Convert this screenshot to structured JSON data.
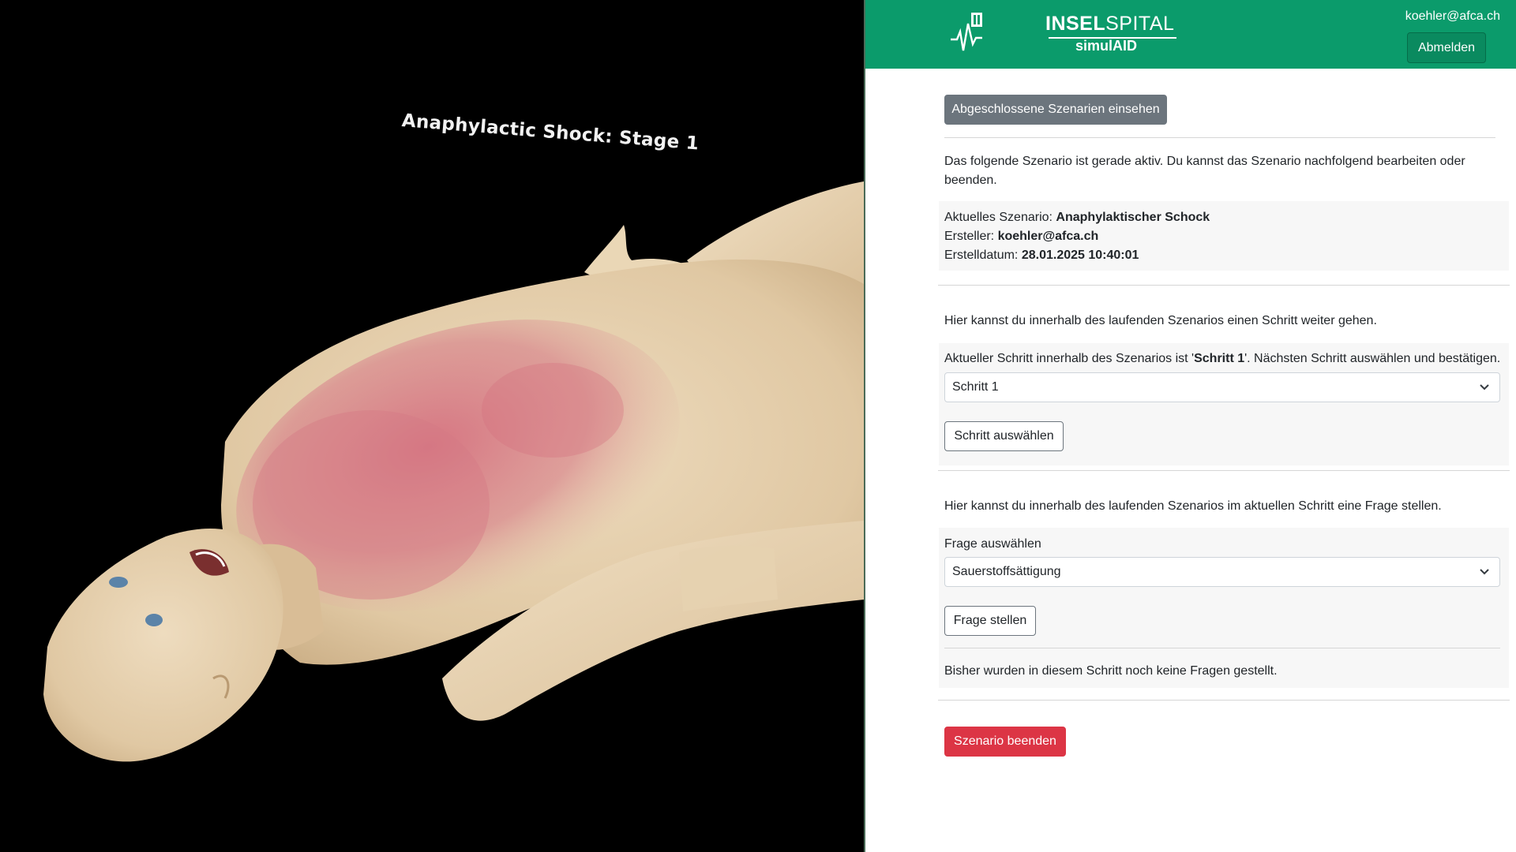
{
  "viewport": {
    "stage_label": "Anaphylactic Shock: Stage 1"
  },
  "header": {
    "brand_name_bold": "INSEL",
    "brand_name_regular": "SPITAL",
    "brand_sub": "simulAID",
    "user_email": "koehler@afca.ch",
    "logout_label": "Abmelden"
  },
  "actions": {
    "view_completed_label": "Abgeschlossene Szenarien einsehen",
    "end_scenario_label": "Szenario beenden"
  },
  "scenario": {
    "intro_text": "Das folgende Szenario ist gerade aktiv. Du kannst das Szenario nachfolgend bearbeiten oder beenden.",
    "current_label": "Aktuelles Szenario:",
    "current_value": "Anaphylaktischer Schock",
    "creator_label": "Ersteller:",
    "creator_value": "koehler@afca.ch",
    "created_label": "Erstelldatum:",
    "created_value": "28.01.2025 10:40:01"
  },
  "step": {
    "intro_text": "Hier kannst du innerhalb des laufenden Szenarios einen Schritt weiter gehen.",
    "current_prefix": "Aktueller Schritt innerhalb des Szenarios ist '",
    "current_step": "Schritt 1",
    "current_suffix": "'. Nächsten Schritt auswählen und bestätigen.",
    "select_value": "Schritt 1",
    "select_button_label": "Schritt auswählen"
  },
  "question": {
    "intro_text": "Hier kannst du innerhalb des laufenden Szenarios im aktuellen Schritt eine Frage stellen.",
    "select_label": "Frage auswählen",
    "select_value": "Sauerstoffsättigung",
    "ask_button_label": "Frage stellen",
    "empty_text": "Bisher wurden in diesem Schritt noch keine Fragen gestellt."
  },
  "colors": {
    "brand_green": "#0b9b6b",
    "danger": "#dc3545",
    "secondary": "#6c757d"
  },
  "icons": {
    "logo": "heartbeat-cross-logo",
    "select_chevron": "chevron-down-icon"
  }
}
